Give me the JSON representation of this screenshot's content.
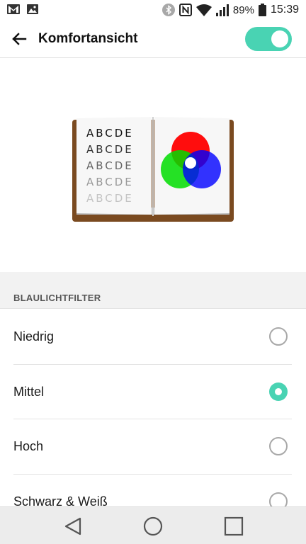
{
  "status_bar": {
    "battery": "89%",
    "time": "15:39",
    "icons": [
      "gmail-icon",
      "gallery-icon",
      "bluetooth-icon",
      "nfc-icon",
      "wifi-icon",
      "signal-icon",
      "battery-icon"
    ]
  },
  "app_bar": {
    "title": "Komfortansicht",
    "toggle_on": true,
    "accent_color": "#49d3b3"
  },
  "illustration": {
    "letter_rows": [
      "ABCDE",
      "ABCDE",
      "ABCDE",
      "ABCDE",
      "ABCDE"
    ],
    "colors": [
      "#ff0000",
      "#00cc00",
      "#0000ff"
    ]
  },
  "section": {
    "header": "BLAULICHTFILTER"
  },
  "options": [
    {
      "label": "Niedrig",
      "selected": false
    },
    {
      "label": "Mittel",
      "selected": true
    },
    {
      "label": "Hoch",
      "selected": false
    },
    {
      "label": "Schwarz & Weiß",
      "selected": false
    }
  ],
  "nav_bar": {
    "icons": [
      "back-triangle-icon",
      "home-circle-icon",
      "recents-square-icon"
    ]
  }
}
